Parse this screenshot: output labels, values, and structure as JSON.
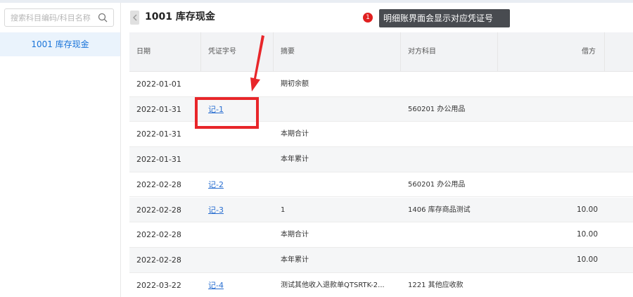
{
  "sidebar": {
    "search_placeholder": "搜索科目编码/科目名称",
    "items": [
      {
        "label": "1001 库存现金"
      }
    ]
  },
  "header": {
    "title": "1001 库存现金"
  },
  "annotation": {
    "badge_number": "1",
    "tooltip_text": "明细账界面会显示对应凭证号",
    "highlight_color": "#e8262a"
  },
  "table": {
    "columns": {
      "date": "日期",
      "voucher": "凭证字号",
      "summary": "摘要",
      "account": "对方科目",
      "debit": "借方"
    },
    "rows": [
      {
        "date": "2022-01-01",
        "voucher": "",
        "summary": "期初余额",
        "account": "",
        "debit": ""
      },
      {
        "date": "2022-01-31",
        "voucher": "记-1",
        "summary": "",
        "account": "560201 办公用品",
        "debit": ""
      },
      {
        "date": "2022-01-31",
        "voucher": "",
        "summary": "本期合计",
        "account": "",
        "debit": ""
      },
      {
        "date": "2022-01-31",
        "voucher": "",
        "summary": "本年累计",
        "account": "",
        "debit": ""
      },
      {
        "date": "2022-02-28",
        "voucher": "记-2",
        "summary": "",
        "account": "560201 办公用品",
        "debit": ""
      },
      {
        "date": "2022-02-28",
        "voucher": "记-3",
        "summary": "1",
        "account": "1406 库存商品测试",
        "debit": "10.00"
      },
      {
        "date": "2022-02-28",
        "voucher": "",
        "summary": "本期合计",
        "account": "",
        "debit": "10.00"
      },
      {
        "date": "2022-02-28",
        "voucher": "",
        "summary": "本年累计",
        "account": "",
        "debit": "10.00"
      },
      {
        "date": "2022-03-22",
        "voucher": "记-4",
        "summary": "测试其他收入退款单QTSRTK-2...",
        "account": "1221 其他应收款",
        "debit": ""
      }
    ]
  },
  "colors": {
    "accent": "#1a74d9",
    "link": "#2a6fd1",
    "tooltip_bg": "#484b50"
  }
}
